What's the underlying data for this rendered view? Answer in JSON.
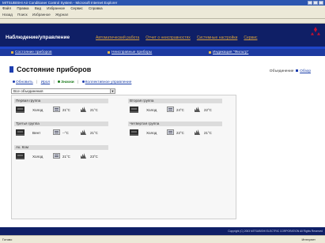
{
  "window": {
    "title": "MITSUBISHI Air Conditioner Control System - Microsoft Internet Explorer",
    "menu": [
      "Файл",
      "Правка",
      "Вид",
      "Избранное",
      "Сервис",
      "Справка"
    ],
    "toolbar": [
      "Назад",
      "Поиск",
      "Избранное",
      "Журнал"
    ]
  },
  "nav": {
    "title": "Наблюдение/управление",
    "links": [
      "Автоматический работа",
      "Отчет о неисправностях",
      "Системные настройки",
      "Сервис"
    ]
  },
  "subnav": {
    "links": [
      "Состояние приборов",
      "Неисправные приборы",
      "Индикация \"Фильтр\""
    ]
  },
  "page": {
    "title": "Состояние приборов",
    "top_right_label": "Объединение",
    "top_right_link": "Обзор",
    "actions": {
      "refresh": "Обновить",
      "mode": "Ирол",
      "current": "Значки",
      "collective": "Коллективное управление"
    },
    "select_value": "Все объединения"
  },
  "groups": [
    {
      "name": "Первая группа",
      "mode": "Холод",
      "set_temp": "21°C",
      "room_temp": "21°C"
    },
    {
      "name": "Вторая группа",
      "mode": "Холод",
      "set_temp": "24°C",
      "room_temp": "22°C"
    },
    {
      "name": "Третья группа",
      "mode": "Вент",
      "set_temp": "--°C",
      "room_temp": "21°C"
    },
    {
      "name": "Четвертая группа",
      "mode": "Холод",
      "set_temp": "22°C",
      "room_temp": "21°C"
    },
    {
      "name": "Ак. Ком",
      "mode": "Холод",
      "set_temp": "21°C",
      "room_temp": "23°C"
    }
  ],
  "footer": {
    "copyright": "Copyright (C) 2003 MITSUBISHI ELECTRIC CORPORATION All Rights Reserved"
  },
  "status": {
    "left": "Готово",
    "zone": "Интернет"
  },
  "colors": {
    "nav_bg": "#0f1f66",
    "accent_link": "#d7a03a",
    "brand_red": "#c8102e"
  }
}
